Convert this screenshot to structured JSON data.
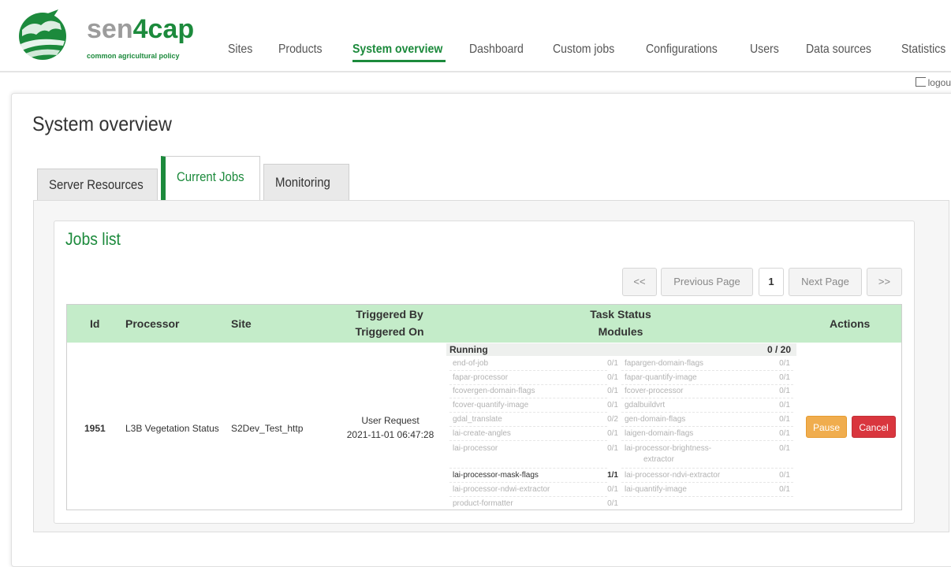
{
  "brand": {
    "name_part1": "sen",
    "name_part2": "4cap",
    "subtitle": "common agricultural policy"
  },
  "nav": {
    "items": [
      {
        "label": "Sites"
      },
      {
        "label": "Products"
      },
      {
        "label": "System overview",
        "active": true
      },
      {
        "label": "Dashboard"
      },
      {
        "label": "Custom jobs"
      },
      {
        "label": "Configurations"
      },
      {
        "label": "Users"
      },
      {
        "label": "Data sources"
      },
      {
        "label": "Statistics"
      }
    ],
    "logout": "logou"
  },
  "page": {
    "title": "System overview"
  },
  "tabs": [
    {
      "label": "Server Resources"
    },
    {
      "label": "Current Jobs",
      "active": true
    },
    {
      "label": "Monitoring"
    }
  ],
  "jobs": {
    "title": "Jobs list",
    "pagination": {
      "first": "<<",
      "prev": "Previous Page",
      "page": "1",
      "next": "Next Page",
      "last": ">>"
    },
    "headers": {
      "id": "Id",
      "processor": "Processor",
      "site": "Site",
      "triggered_by": "Triggered By",
      "triggered_on": "Triggered On",
      "task_status": "Task Status",
      "modules": "Modules",
      "actions": "Actions"
    },
    "row": {
      "id": "1951",
      "processor": "L3B Vegetation Status",
      "site": "S2Dev_Test_http",
      "triggered_by": "User Request",
      "triggered_on": "2021-11-01 06:47:28",
      "status": "Running",
      "status_count": "0 / 20",
      "modules": [
        {
          "name": "end-of-job",
          "count": "0/1"
        },
        {
          "name": "fapargen-domain-flags",
          "count": "0/1"
        },
        {
          "name": "fapar-processor",
          "count": "0/1"
        },
        {
          "name": "fapar-quantify-image",
          "count": "0/1"
        },
        {
          "name": "fcovergen-domain-flags",
          "count": "0/1"
        },
        {
          "name": "fcover-processor",
          "count": "0/1"
        },
        {
          "name": "fcover-quantify-image",
          "count": "0/1"
        },
        {
          "name": "gdalbuildvrt",
          "count": "0/1"
        },
        {
          "name": "gdal_translate",
          "count": "0/2"
        },
        {
          "name": "gen-domain-flags",
          "count": "0/1"
        },
        {
          "name": "lai-create-angles",
          "count": "0/1"
        },
        {
          "name": "laigen-domain-flags",
          "count": "0/1"
        },
        {
          "name": "lai-processor",
          "count": "0/1"
        },
        {
          "name": "lai-processor-brightness-",
          "name2": "extractor",
          "count": "0/1"
        },
        {
          "name": "lai-processor-mask-flags",
          "count": "1/1",
          "active": true
        },
        {
          "name": "lai-processor-ndvi-extractor",
          "count": "0/1"
        },
        {
          "name": "lai-processor-ndwi-extractor",
          "count": "0/1"
        },
        {
          "name": "lai-quantify-image",
          "count": "0/1"
        },
        {
          "name": "product-formatter",
          "count": "0/1"
        }
      ],
      "actions": {
        "pause": "Pause",
        "cancel": "Cancel"
      }
    }
  },
  "colors": {
    "brand_green": "#1c8a3c",
    "header_green": "#c4ecc9",
    "pause": "#f0ad4e",
    "cancel": "#d9363e"
  }
}
